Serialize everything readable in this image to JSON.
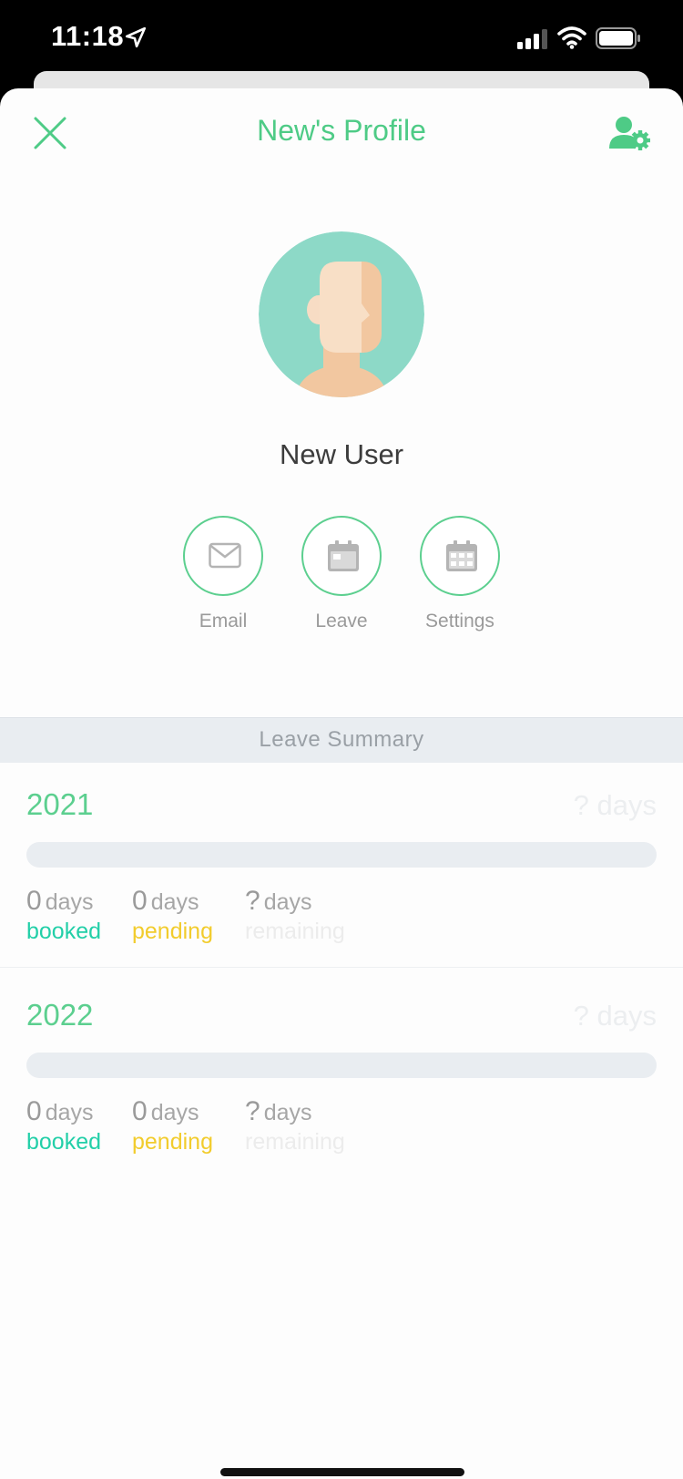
{
  "status_bar": {
    "time": "11:18"
  },
  "header": {
    "title": "New's Profile"
  },
  "profile": {
    "name": "New User"
  },
  "actions": [
    {
      "label": "Email",
      "icon": "envelope-icon"
    },
    {
      "label": "Leave",
      "icon": "calendar-icon"
    },
    {
      "label": "Settings",
      "icon": "calendar-grid-icon"
    }
  ],
  "leave_summary": {
    "title": "Leave Summary",
    "years": [
      {
        "year": "2021",
        "total": "? days",
        "progress": 0,
        "booked": {
          "count": "0",
          "unit": "days",
          "label": "booked"
        },
        "pending": {
          "count": "0",
          "unit": "days",
          "label": "pending"
        },
        "remaining": {
          "count": "?",
          "unit": "days",
          "label": "remaining"
        }
      },
      {
        "year": "2022",
        "total": "? days",
        "progress": 0,
        "booked": {
          "count": "0",
          "unit": "days",
          "label": "booked"
        },
        "pending": {
          "count": "0",
          "unit": "days",
          "label": "pending"
        },
        "remaining": {
          "count": "?",
          "unit": "days",
          "label": "remaining"
        }
      }
    ]
  },
  "colors": {
    "accent": "#4ecb86",
    "booked": "#22cfa8",
    "pending": "#f2cc2c",
    "remaining": "#ececec",
    "avatar_bg": "#8dd9c7"
  }
}
